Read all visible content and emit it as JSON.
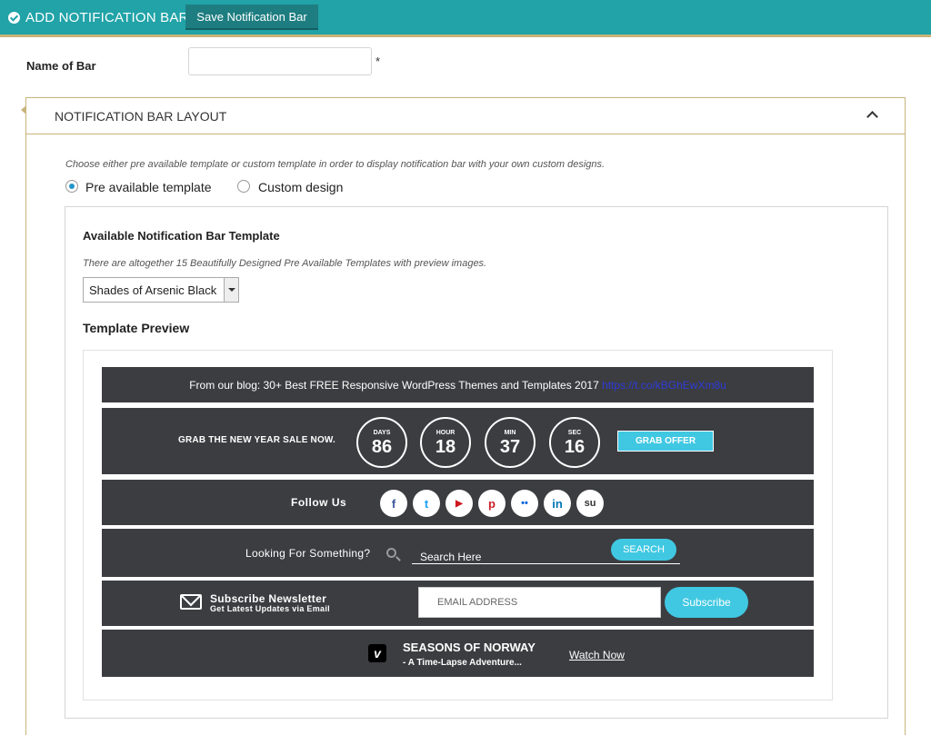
{
  "header": {
    "title": "ADD NOTIFICATION BAR",
    "save_label": "Save Notification Bar"
  },
  "name_field": {
    "label": "Name of Bar",
    "value": "",
    "required_mark": "*"
  },
  "layout_panel": {
    "title": "NOTIFICATION BAR LAYOUT",
    "instruction": "Choose either pre available template or custom template in order to display notification bar with your own custom designs.",
    "options": [
      {
        "label": "Pre available template",
        "selected": true
      },
      {
        "label": "Custom design",
        "selected": false
      }
    ],
    "available_title": "Available Notification Bar Template",
    "available_subtitle": "There are altogether 15 Beautifully Designed Pre Available Templates with preview images.",
    "selected_template": "Shades of Arsenic Black",
    "preview_title": "Template Preview"
  },
  "preview": {
    "blog": {
      "text": "From our blog: 30+ Best FREE Responsive WordPress Themes and Templates 2017 ",
      "link": "https://t.co/kBGhEwXm8u"
    },
    "sale": {
      "text": "GRAB THE NEW YEAR SALE NOW.",
      "countdown": [
        {
          "unit": "DAYS",
          "value": "86"
        },
        {
          "unit": "HOUR",
          "value": "18"
        },
        {
          "unit": "MIN",
          "value": "37"
        },
        {
          "unit": "SEC",
          "value": "16"
        }
      ],
      "button": "GRAB OFFER"
    },
    "follow": {
      "text": "Follow Us",
      "icons": [
        {
          "name": "facebook-icon",
          "glyph": "f",
          "color": "#3b5998"
        },
        {
          "name": "twitter-icon",
          "glyph": "t",
          "color": "#1da1f2"
        },
        {
          "name": "youtube-icon",
          "glyph": "▶",
          "color": "#cc181e"
        },
        {
          "name": "pinterest-icon",
          "glyph": "p",
          "color": "#cb2027"
        },
        {
          "name": "flickr-icon",
          "glyph": "••",
          "color": "#0063dc"
        },
        {
          "name": "linkedin-icon",
          "glyph": "in",
          "color": "#0077b5"
        },
        {
          "name": "stumbleupon-icon",
          "glyph": "su",
          "color": "#333333"
        }
      ]
    },
    "search": {
      "text": "Looking For Something?",
      "placeholder": "Search Here",
      "button": "SEARCH"
    },
    "newsletter": {
      "title": "Subscribe Newsletter",
      "subtitle": "Get Latest Updates via Email",
      "placeholder": "EMAIL ADDRESS",
      "button": "Subscribe"
    },
    "video": {
      "icon_glyph": "v",
      "title": "SEASONS OF NORWAY",
      "subtitle": "- A Time-Lapse Adventure...",
      "link": "Watch Now"
    }
  }
}
